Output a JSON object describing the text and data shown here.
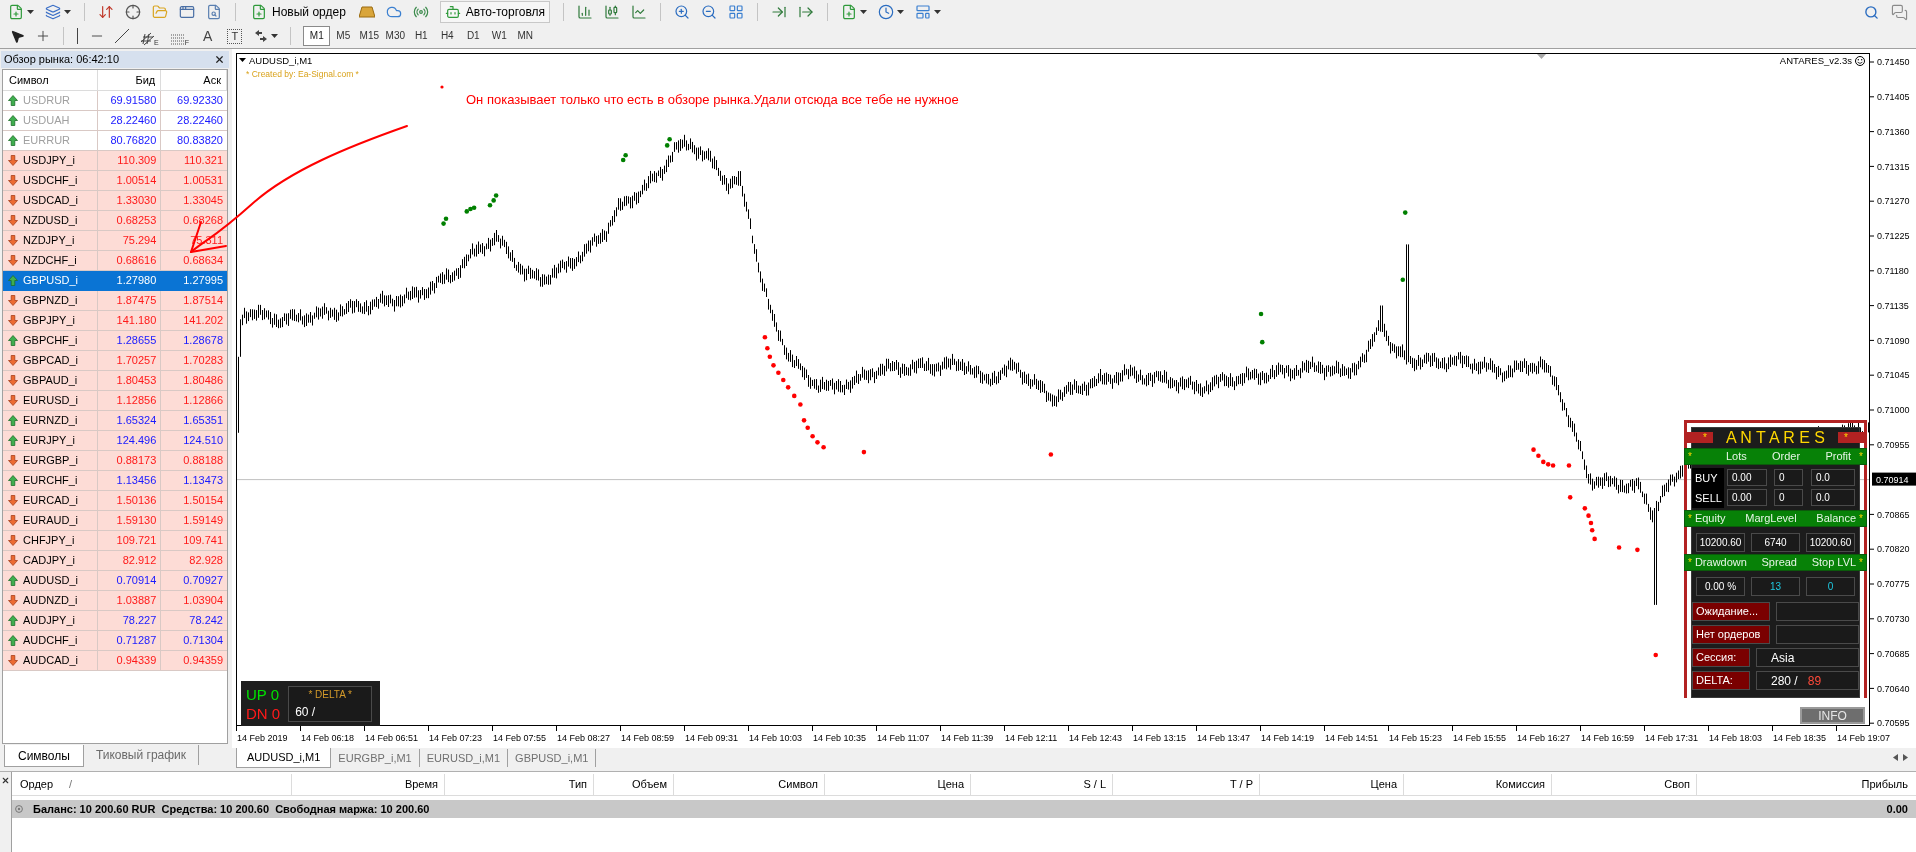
{
  "toolbar": {
    "new_order": "Новый ордер",
    "auto_trading": "Авто-торговля",
    "drawing_tools": [
      {
        "kind": "channel",
        "mark": "E"
      },
      {
        "kind": "fibo",
        "mark": "F"
      },
      {
        "kind": "text",
        "mark": "A"
      },
      {
        "kind": "label",
        "mark": "T"
      }
    ],
    "timeframes": [
      {
        "label": "M1",
        "selected": true
      },
      {
        "label": "M5",
        "selected": false
      },
      {
        "label": "M15",
        "selected": false
      },
      {
        "label": "M30",
        "selected": false
      },
      {
        "label": "H1",
        "selected": false
      },
      {
        "label": "H4",
        "selected": false
      },
      {
        "label": "D1",
        "selected": false
      },
      {
        "label": "W1",
        "selected": false
      },
      {
        "label": "MN",
        "selected": false
      }
    ]
  },
  "market_watch": {
    "title": "Обзор рынка: 06:42:10",
    "columns": [
      "Символ",
      "Бид",
      "Аск"
    ],
    "rows": [
      {
        "symbol": "USDRUR",
        "bid": "69.91580",
        "ask": "69.92330",
        "rising": true,
        "disabled": true,
        "selected": false
      },
      {
        "symbol": "USDUAH",
        "bid": "28.22460",
        "ask": "28.22460",
        "rising": true,
        "disabled": true,
        "selected": false
      },
      {
        "symbol": "EURRUR",
        "bid": "80.76820",
        "ask": "80.83820",
        "rising": true,
        "disabled": true,
        "selected": false
      },
      {
        "symbol": "USDJPY_i",
        "bid": "110.309",
        "ask": "110.321",
        "rising": false,
        "disabled": false,
        "selected": false
      },
      {
        "symbol": "USDCHF_i",
        "bid": "1.00514",
        "ask": "1.00531",
        "rising": false,
        "disabled": false,
        "selected": false
      },
      {
        "symbol": "USDCAD_i",
        "bid": "1.33030",
        "ask": "1.33045",
        "rising": false,
        "disabled": false,
        "selected": false
      },
      {
        "symbol": "NZDUSD_i",
        "bid": "0.68253",
        "ask": "0.68268",
        "rising": false,
        "disabled": false,
        "selected": false
      },
      {
        "symbol": "NZDJPY_i",
        "bid": "75.294",
        "ask": "75.311",
        "rising": false,
        "disabled": false,
        "selected": false
      },
      {
        "symbol": "NZDCHF_i",
        "bid": "0.68616",
        "ask": "0.68634",
        "rising": false,
        "disabled": false,
        "selected": false
      },
      {
        "symbol": "GBPUSD_i",
        "bid": "1.27980",
        "ask": "1.27995",
        "rising": true,
        "disabled": false,
        "selected": true
      },
      {
        "symbol": "GBPNZD_i",
        "bid": "1.87475",
        "ask": "1.87514",
        "rising": false,
        "disabled": false,
        "selected": false
      },
      {
        "symbol": "GBPJPY_i",
        "bid": "141.180",
        "ask": "141.202",
        "rising": false,
        "disabled": false,
        "selected": false
      },
      {
        "symbol": "GBPCHF_i",
        "bid": "1.28655",
        "ask": "1.28678",
        "rising": true,
        "disabled": false,
        "selected": false
      },
      {
        "symbol": "GBPCAD_i",
        "bid": "1.70257",
        "ask": "1.70283",
        "rising": false,
        "disabled": false,
        "selected": false
      },
      {
        "symbol": "GBPAUD_i",
        "bid": "1.80453",
        "ask": "1.80486",
        "rising": false,
        "disabled": false,
        "selected": false
      },
      {
        "symbol": "EURUSD_i",
        "bid": "1.12856",
        "ask": "1.12866",
        "rising": false,
        "disabled": false,
        "selected": false
      },
      {
        "symbol": "EURNZD_i",
        "bid": "1.65324",
        "ask": "1.65351",
        "rising": true,
        "disabled": false,
        "selected": false
      },
      {
        "symbol": "EURJPY_i",
        "bid": "124.496",
        "ask": "124.510",
        "rising": true,
        "disabled": false,
        "selected": false
      },
      {
        "symbol": "EURGBP_i",
        "bid": "0.88173",
        "ask": "0.88188",
        "rising": false,
        "disabled": false,
        "selected": false
      },
      {
        "symbol": "EURCHF_i",
        "bid": "1.13456",
        "ask": "1.13473",
        "rising": true,
        "disabled": false,
        "selected": false
      },
      {
        "symbol": "EURCAD_i",
        "bid": "1.50136",
        "ask": "1.50154",
        "rising": false,
        "disabled": false,
        "selected": false
      },
      {
        "symbol": "EURAUD_i",
        "bid": "1.59130",
        "ask": "1.59149",
        "rising": false,
        "disabled": false,
        "selected": false
      },
      {
        "symbol": "CHFJPY_i",
        "bid": "109.721",
        "ask": "109.741",
        "rising": false,
        "disabled": false,
        "selected": false
      },
      {
        "symbol": "CADJPY_i",
        "bid": "82.912",
        "ask": "82.928",
        "rising": false,
        "disabled": false,
        "selected": false
      },
      {
        "symbol": "AUDUSD_i",
        "bid": "0.70914",
        "ask": "0.70927",
        "rising": true,
        "disabled": false,
        "selected": false
      },
      {
        "symbol": "AUDNZD_i",
        "bid": "1.03887",
        "ask": "1.03904",
        "rising": false,
        "disabled": false,
        "selected": false
      },
      {
        "symbol": "AUDJPY_i",
        "bid": "78.227",
        "ask": "78.242",
        "rising": true,
        "disabled": false,
        "selected": false
      },
      {
        "symbol": "AUDCHF_i",
        "bid": "0.71287",
        "ask": "0.71304",
        "rising": true,
        "disabled": false,
        "selected": false
      },
      {
        "symbol": "AUDCAD_i",
        "bid": "0.94339",
        "ask": "0.94359",
        "rising": false,
        "disabled": false,
        "selected": false
      }
    ],
    "tabs": [
      {
        "label": "Символы",
        "selected": true
      },
      {
        "label": "Тиковый график",
        "selected": false
      }
    ]
  },
  "chart": {
    "title": "AUDUSD_i,M1",
    "credit": "* Created by: Ea-Signal.com *",
    "indicator": "ANTARES_v2.3s",
    "note": "Он показывает только что есть в обзоре рынка.Удали отсюда все тебе не нужное",
    "price_labels": [
      {
        "text": "0.71450",
        "current": false
      },
      {
        "text": "0.71405",
        "current": false
      },
      {
        "text": "0.71360",
        "current": false
      },
      {
        "text": "0.71315",
        "current": false
      },
      {
        "text": "0.71270",
        "current": false
      },
      {
        "text": "0.71225",
        "current": false
      },
      {
        "text": "0.71180",
        "current": false
      },
      {
        "text": "0.71135",
        "current": false
      },
      {
        "text": "0.71090",
        "current": false
      },
      {
        "text": "0.71045",
        "current": false
      },
      {
        "text": "0.71000",
        "current": false
      },
      {
        "text": "0.70955",
        "current": false
      },
      {
        "text": "0.70914",
        "current": true
      },
      {
        "text": "0.70865",
        "current": false
      },
      {
        "text": "0.70820",
        "current": false
      },
      {
        "text": "0.70775",
        "current": false
      },
      {
        "text": "0.70730",
        "current": false
      },
      {
        "text": "0.70685",
        "current": false
      },
      {
        "text": "0.70640",
        "current": false
      },
      {
        "text": "0.70595",
        "current": false
      }
    ],
    "time_labels": [
      "14 Feb 2019",
      "14 Feb 06:18",
      "14 Feb 06:51",
      "14 Feb 07:23",
      "14 Feb 07:55",
      "14 Feb 08:27",
      "14 Feb 08:59",
      "14 Feb 09:31",
      "14 Feb 10:03",
      "14 Feb 10:35",
      "14 Feb 11:07",
      "14 Feb 11:39",
      "14 Feb 12:11",
      "14 Feb 12:43",
      "14 Feb 13:15",
      "14 Feb 13:47",
      "14 Feb 14:19",
      "14 Feb 14:51",
      "14 Feb 15:23",
      "14 Feb 15:55",
      "14 Feb 16:27",
      "14 Feb 16:59",
      "14 Feb 17:31",
      "14 Feb 18:03",
      "14 Feb 18:35",
      "14 Feb 19:07"
    ],
    "delta": {
      "up": "UP 0",
      "down": "DN 0",
      "title": "* DELTA *",
      "value": "60 /"
    },
    "antares": {
      "title": {
        "left": "*",
        "text": "A N T A R E S",
        "right": "*"
      },
      "sections": [
        {
          "kind": "header",
          "left": "*",
          "cells": [
            "Lots",
            "Order",
            "Profit"
          ],
          "right": "*"
        },
        {
          "kind": "trade_rows",
          "rows": [
            {
              "label": "BUY",
              "cells": [
                "0.00",
                "0",
                "0.0"
              ]
            },
            {
              "label": "SELL",
              "cells": [
                "0.00",
                "0",
                "0.0"
              ]
            }
          ]
        },
        {
          "kind": "header",
          "left": "*",
          "cells": [
            "Equity",
            "MargLevel",
            "Balance"
          ],
          "right": "*"
        },
        {
          "kind": "values",
          "cells": [
            {
              "text": "10200.60",
              "highlighted": false
            },
            {
              "text": "6740",
              "highlighted": false
            },
            {
              "text": "10200.60",
              "highlighted": false
            }
          ]
        },
        {
          "kind": "header",
          "left": "*",
          "cells": [
            "Drawdown",
            "Spread",
            "Stop LVL"
          ],
          "right": "*"
        },
        {
          "kind": "values",
          "cells": [
            {
              "text": "0.00 %",
              "highlighted": false
            },
            {
              "text": "13",
              "highlighted": true
            },
            {
              "text": "0",
              "highlighted": true
            }
          ]
        },
        {
          "kind": "status_rows",
          "rows": [
            {
              "label": "Ожидание..."
            },
            {
              "label": "Нет ордеров"
            }
          ]
        },
        {
          "kind": "info_rows",
          "rows": [
            {
              "label": "Сессия:",
              "value": "Asia"
            },
            {
              "label": "DELTA:",
              "value": "280 /",
              "second_value": "89"
            }
          ]
        }
      ]
    },
    "info_button": "INFO",
    "tabs": [
      {
        "label": "AUDUSD_i,M1",
        "selected": true
      },
      {
        "label": "EURGBP_i,M1",
        "selected": false
      },
      {
        "label": "EURUSD_i,M1",
        "selected": false
      },
      {
        "label": "GBPUSD_i,M1",
        "selected": false
      }
    ]
  },
  "terminal": {
    "columns": [
      {
        "label": "Ордер",
        "mark": "/"
      },
      {
        "label": "Время"
      },
      {
        "label": "Тип"
      },
      {
        "label": "Объем"
      },
      {
        "label": "Символ"
      },
      {
        "label": "Цена"
      },
      {
        "label": "S / L"
      },
      {
        "label": "T / P"
      },
      {
        "label": "Цена"
      },
      {
        "label": "Комиссия"
      },
      {
        "label": "Своп"
      },
      {
        "label": "Прибыль"
      }
    ],
    "summary": "Баланс: 10 200.60 RUR  Средства: 10 200.60  Свободная маржа: 10 200.60",
    "profit": "0.00"
  }
}
